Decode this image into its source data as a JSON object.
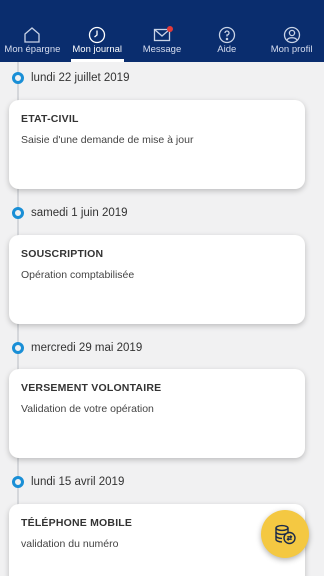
{
  "nav": {
    "items": [
      {
        "label": "Mon épargne",
        "icon": "home-icon"
      },
      {
        "label": "Mon journal",
        "icon": "clock-icon",
        "active": true
      },
      {
        "label": "Message",
        "icon": "mail-icon",
        "has_badge": true
      },
      {
        "label": "Aide",
        "icon": "help-icon"
      },
      {
        "label": "Mon profil",
        "icon": "profile-icon"
      }
    ]
  },
  "journal": {
    "entries": [
      {
        "date": "lundi 22 juillet 2019",
        "title": "ETAT-CIVIL",
        "description": "Saisie d'une demande de mise à jour"
      },
      {
        "date": "samedi 1 juin 2019",
        "title": "SOUSCRIPTION",
        "description": "Opération comptabilisée"
      },
      {
        "date": "mercredi 29 mai 2019",
        "title": "VERSEMENT VOLONTAIRE",
        "description": "Validation de votre opération"
      },
      {
        "date": "lundi 15 avril 2019",
        "title": "TÉLÉPHONE MOBILE",
        "description": "validation du numéro"
      }
    ]
  },
  "fab": {
    "icon": "coins-icon"
  },
  "colors": {
    "nav_bg": "#0a2d6e",
    "accent": "#1a8fd6",
    "fab": "#f4c842"
  }
}
